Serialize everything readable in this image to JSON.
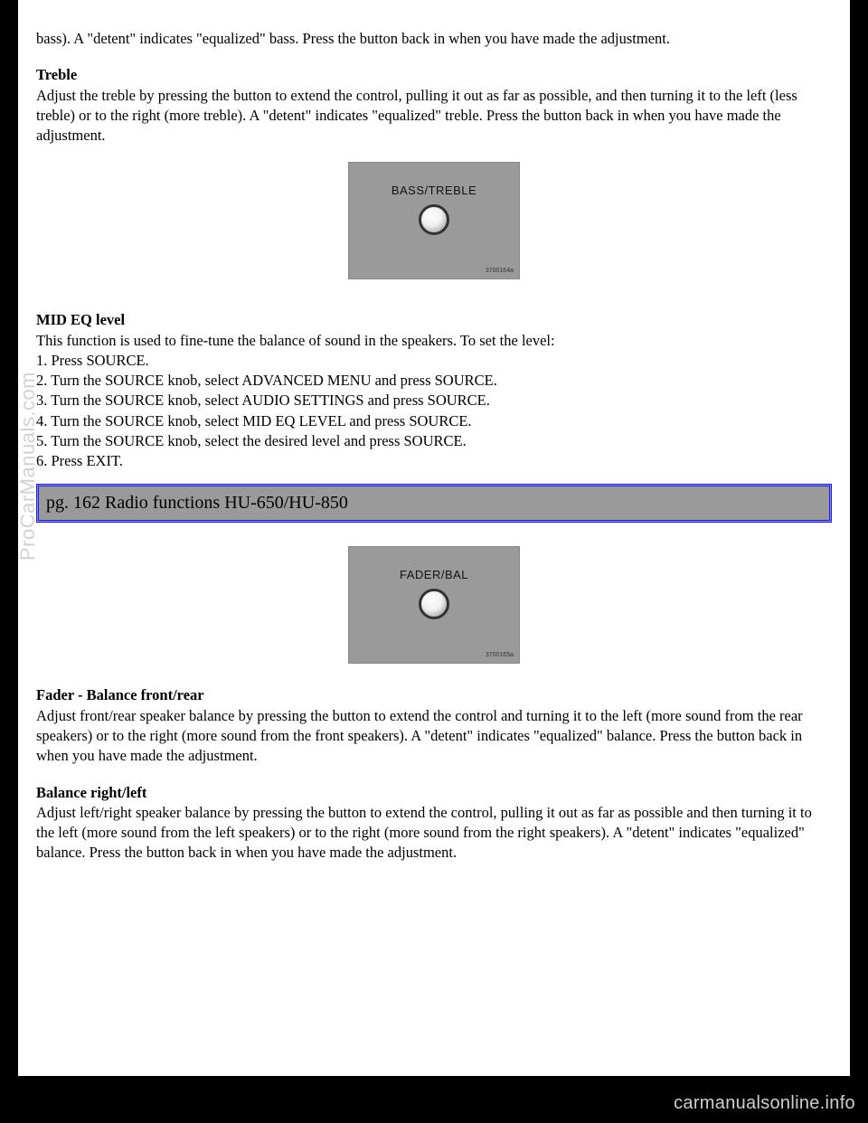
{
  "intro": "bass). A \"detent\" indicates \"equalized\" bass. Press the button back in when you have made the adjustment.",
  "treble": {
    "heading": "Treble",
    "body": "Adjust the treble by pressing the button to extend the control, pulling it out as far as possible, and then turning it to the left (less treble) or to the right (more treble). A \"detent\" indicates \"equalized\" treble. Press the button back in when you have made the adjustment."
  },
  "figure1": {
    "label": "BASS/TREBLE",
    "tag": "3700164a"
  },
  "mideq": {
    "heading": "MID EQ level",
    "intro": "This function is used to fine-tune the balance of sound in the speakers. To set the level:",
    "steps": [
      "1. Press SOURCE.",
      "2. Turn the SOURCE knob, select ADVANCED MENU and press SOURCE.",
      "3. Turn the SOURCE knob, select AUDIO SETTINGS and press SOURCE.",
      "4. Turn the SOURCE knob, select MID EQ LEVEL and press SOURCE.",
      "5. Turn the SOURCE knob, select the desired level and press SOURCE.",
      "6. Press EXIT."
    ]
  },
  "sectionbar": {
    "pg": "pg.",
    "rest": " 162 Radio functions HU-650/HU-850"
  },
  "figure2": {
    "label": "FADER/BAL",
    "tag": "3700165a"
  },
  "fader": {
    "heading": "Fader - Balance front/rear",
    "body": "Adjust front/rear speaker balance by pressing the button to extend the control and turning it to the left (more sound from the rear speakers) or to the right (more sound from the front speakers). A \"detent\" indicates \"equalized\" balance. Press the button back in when you have made the adjustment."
  },
  "balance": {
    "heading": "Balance right/left",
    "body": "Adjust left/right speaker balance by pressing the button to extend the control, pulling it out as far as possible and then turning it to the left (more sound from the left speakers) or to the right (more sound from the right speakers). A \"detent\" indicates \"equalized\" balance. Press the button back in when you have made the adjustment."
  },
  "watermark": "ProCarManuals.com",
  "footer": "carmanualsonline.info"
}
